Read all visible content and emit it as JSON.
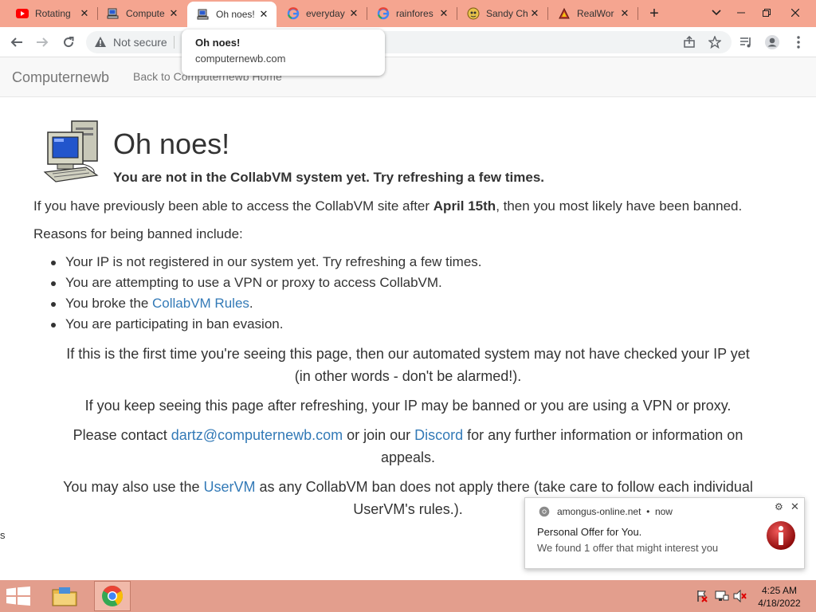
{
  "tabs": [
    {
      "title": "Rotating",
      "icon": "youtube-icon"
    },
    {
      "title": "Compute",
      "icon": "computer-icon"
    },
    {
      "title": "Oh noes!",
      "icon": "computer-icon",
      "active": true
    },
    {
      "title": "everyday",
      "icon": "google-icon"
    },
    {
      "title": "rainfores",
      "icon": "google-icon"
    },
    {
      "title": "Sandy Ch",
      "icon": "sandy-icon"
    },
    {
      "title": "RealWor",
      "icon": "realworld-icon"
    }
  ],
  "omnibox": {
    "security_label": "Not secure"
  },
  "hover_card": {
    "title": "Oh noes!",
    "domain": "computernewb.com"
  },
  "site_nav": {
    "brand": "Computernewb",
    "back_link": "Back to Computernewb Home"
  },
  "page": {
    "heading": "Oh noes!",
    "subheading": "You are not in the CollabVM system yet. Try refreshing a few times.",
    "intro_prefix": "If you have previously been able to access the CollabVM site after ",
    "intro_date": "April 15th",
    "intro_suffix": ", then you most likely have been banned.",
    "reasons_label": "Reasons for being banned include:",
    "reasons": [
      "Your IP is not registered in our system yet. Try refreshing a few times.",
      "You are attempting to use a VPN or proxy to access CollabVM.",
      "You are participating in ban evasion."
    ],
    "reason_rules_prefix": "You broke the ",
    "reason_rules_link": "CollabVM Rules",
    "reason_rules_suffix": ".",
    "first_time_line1": "If this is the first time you're seeing this page, then our automated system may not have checked your IP yet",
    "first_time_line2": "(in other words - don't be alarmed!).",
    "keep_seeing": "If you keep seeing this page after refreshing, your IP may be banned or you are using a VPN or proxy.",
    "contact_prefix": "Please contact ",
    "contact_email": "dartz@computernewb.com",
    "contact_middle": " or join our ",
    "contact_discord": "Discord",
    "contact_suffix_line1": " for any further information or information on",
    "contact_suffix_line2": "appeals.",
    "uservm_prefix": "You may also use the ",
    "uservm_link": "UserVM",
    "uservm_suffix_line1": " as any CollabVM ban does not apply there (take care to follow each individual",
    "uservm_suffix_line2": "UserVM's rules.).",
    "edge_text": "s"
  },
  "notification": {
    "source": "amongus-online.net",
    "dot": "•",
    "time": "now",
    "title": "Personal Offer for You.",
    "body": "We found 1 offer that might interest you"
  },
  "taskbar": {
    "time": "4:25 AM",
    "date": "4/18/2022"
  },
  "colors": {
    "tabstrip": "#f5a590",
    "taskbar": "#e39e8d",
    "link": "#337ab7"
  }
}
